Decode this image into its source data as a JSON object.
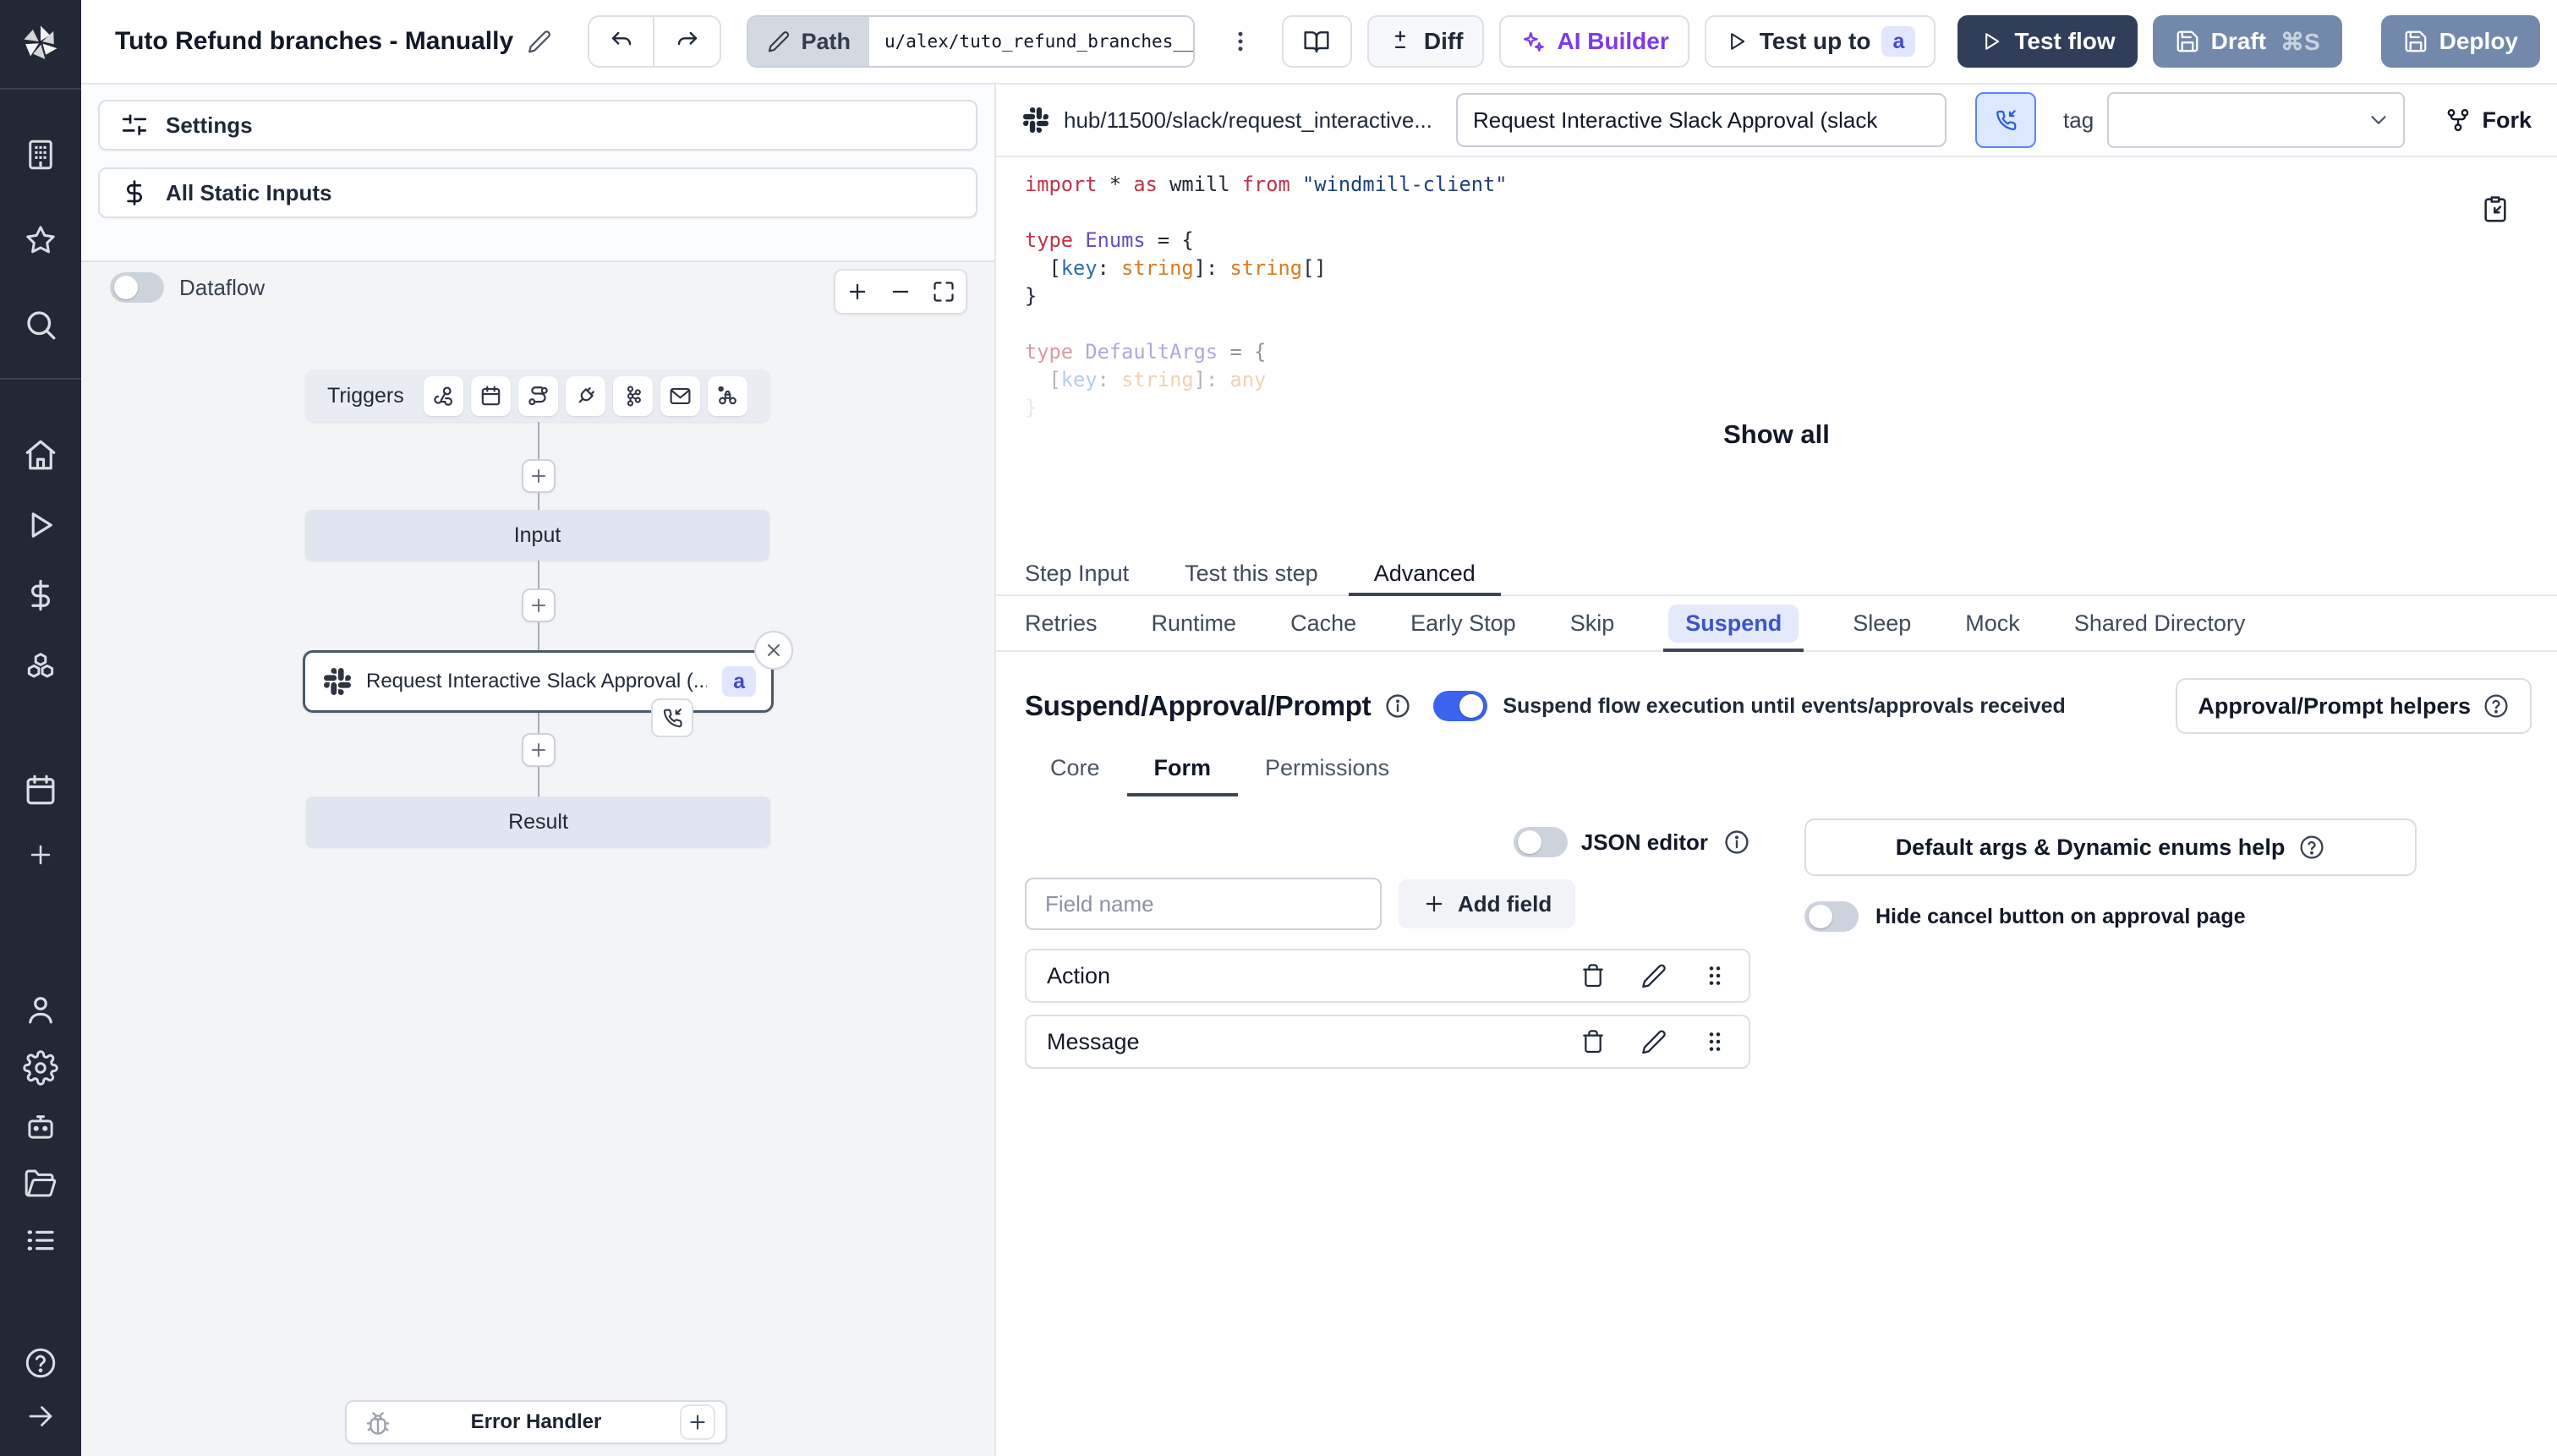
{
  "colors": {
    "sidebar_bg": "#222836",
    "accent_blue": "#3b63ee",
    "steel_button": "#7289ac",
    "dark_button": "#313e59",
    "ai_purple": "#7c3aed",
    "suspend_active": "#3d56c5",
    "badge_bg": "#e2e6fc",
    "badge_text": "#4547c9"
  },
  "topbar": {
    "title": "Tuto Refund branches - Manually",
    "path_label": "Path",
    "path_value": "u/alex/tuto_refund_branches__",
    "diff_label": "Diff",
    "ai_builder_label": "AI Builder",
    "test_up_to_label": "Test up to",
    "test_up_to_badge": "a",
    "test_flow_label": "Test flow",
    "draft_label": "Draft",
    "draft_shortcut": "⌘S",
    "deploy_label": "Deploy"
  },
  "left_panel": {
    "settings_label": "Settings",
    "static_inputs_label": "All Static Inputs",
    "dataflow_label": "Dataflow",
    "graph": {
      "triggers_label": "Triggers",
      "input_label": "Input",
      "step_label": "Request Interactive Slack Approval (...",
      "step_badge": "a",
      "result_label": "Result",
      "error_handler_label": "Error Handler"
    }
  },
  "script_header": {
    "hub_path": "hub/11500/slack/request_interactive...",
    "name_value": "Request Interactive Slack Approval (slack",
    "tag_label": "tag",
    "fork_label": "Fork"
  },
  "code": {
    "show_all": "Show all",
    "lines": [
      [
        {
          "t": "import",
          "c": "red"
        },
        {
          "t": " * ",
          "c": "fg"
        },
        {
          "t": "as",
          "c": "red"
        },
        {
          "t": " wmill ",
          "c": "fg"
        },
        {
          "t": "from",
          "c": "red"
        },
        {
          "t": " ",
          "c": "fg"
        },
        {
          "t": "\"windmill-client\"",
          "c": "str"
        }
      ],
      [],
      [
        {
          "t": "type",
          "c": "red"
        },
        {
          "t": " ",
          "c": "fg"
        },
        {
          "t": "Enums",
          "c": "purple"
        },
        {
          "t": " = {",
          "c": "fg"
        }
      ],
      [
        {
          "t": "  [",
          "c": "fg"
        },
        {
          "t": "key",
          "c": "blue"
        },
        {
          "t": ": ",
          "c": "fg"
        },
        {
          "t": "string",
          "c": "orange"
        },
        {
          "t": "]: ",
          "c": "fg"
        },
        {
          "t": "string",
          "c": "orange"
        },
        {
          "t": "[]",
          "c": "fg"
        }
      ],
      [
        {
          "t": "}",
          "c": "fg"
        }
      ],
      [],
      [
        {
          "t": "type",
          "c": "red"
        },
        {
          "t": " ",
          "c": "fg"
        },
        {
          "t": "DefaultArgs",
          "c": "purple"
        },
        {
          "t": " = {",
          "c": "fg"
        }
      ],
      [
        {
          "t": "  [",
          "c": "fg"
        },
        {
          "t": "key",
          "c": "blue"
        },
        {
          "t": ": ",
          "c": "fg"
        },
        {
          "t": "string",
          "c": "orange"
        },
        {
          "t": "]: ",
          "c": "fg"
        },
        {
          "t": "any",
          "c": "orange"
        }
      ],
      [
        {
          "t": "}",
          "c": "fg"
        }
      ]
    ]
  },
  "step_tabs": [
    "Step Input",
    "Test this step",
    "Advanced"
  ],
  "advanced_tabs": [
    "Retries",
    "Runtime",
    "Cache",
    "Early Stop",
    "Skip",
    "Suspend",
    "Sleep",
    "Mock",
    "Shared Directory"
  ],
  "suspend": {
    "title": "Suspend/Approval/Prompt",
    "toggle_label": "Suspend flow execution until events/approvals received",
    "helpers_button": "Approval/Prompt helpers",
    "tabs": [
      "Core",
      "Form",
      "Permissions"
    ],
    "form": {
      "json_editor_label": "JSON editor",
      "default_args_button": "Default args & Dynamic enums help",
      "field_placeholder": "Field name",
      "add_field_label": "Add field",
      "hide_cancel_label": "Hide cancel button on approval page",
      "fields": [
        {
          "label": "Action"
        },
        {
          "label": "Message"
        }
      ]
    }
  }
}
